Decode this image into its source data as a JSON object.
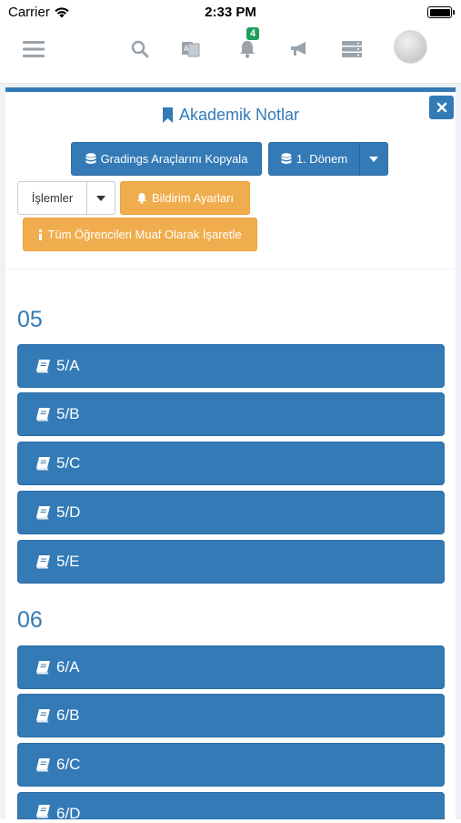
{
  "status_bar": {
    "carrier": "Carrier",
    "time": "2:33 PM"
  },
  "topnav": {
    "notification_count": "4"
  },
  "panel": {
    "title": "Akademik Notlar",
    "copy_button": "Gradings Araçlarını Kopyala",
    "term_select": "1. Dönem",
    "actions_dropdown": "İşlemler",
    "notification_settings": "Bildirim Ayarları",
    "mark_exempt": "Tüm Öğrencileri Muaf Olarak İşaretle"
  },
  "grades": [
    {
      "label": "05",
      "classes": [
        "5/A",
        "5/B",
        "5/C",
        "5/D",
        "5/E"
      ]
    },
    {
      "label": "06",
      "classes": [
        "6/A",
        "6/B",
        "6/C",
        "6/D"
      ]
    }
  ],
  "colors": {
    "primary": "#337ab7",
    "warning": "#f0ad4e",
    "badge": "#1e9e5a",
    "nav_icon": "#9aa3aa"
  },
  "icons": [
    "wifi-icon",
    "hamburger-icon",
    "search-icon",
    "translate-icon",
    "bell-icon",
    "megaphone-icon",
    "server-icon",
    "bookmark-icon",
    "close-icon",
    "database-icon",
    "caret-down-icon",
    "info-icon",
    "book-icon"
  ]
}
